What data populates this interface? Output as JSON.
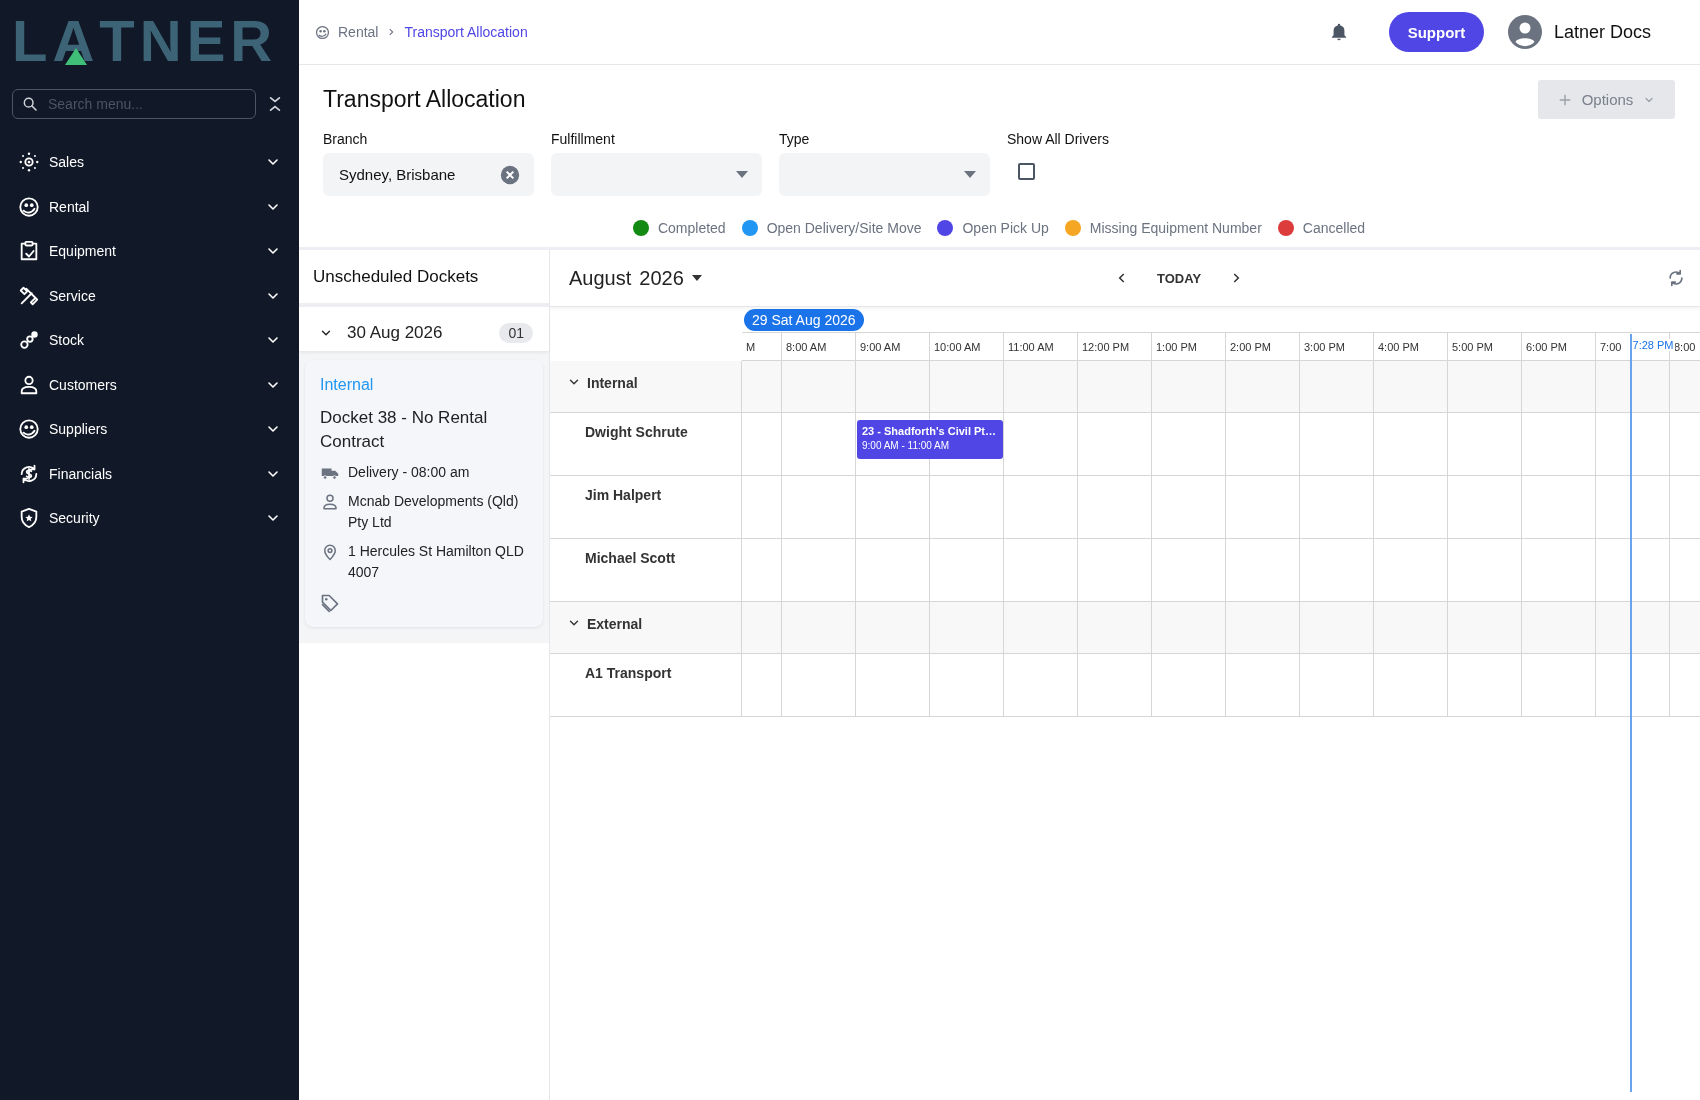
{
  "sidebar": {
    "logo": "LATNER",
    "search": {
      "placeholder": "Search menu..."
    },
    "items": [
      {
        "label": "Sales",
        "expanded": false
      },
      {
        "label": "Rental",
        "expanded": false
      },
      {
        "label": "Equipment",
        "expanded": false
      },
      {
        "label": "Service",
        "expanded": false
      },
      {
        "label": "Stock",
        "expanded": false
      },
      {
        "label": "Customers",
        "expanded": false
      },
      {
        "label": "Suppliers",
        "expanded": false
      },
      {
        "label": "Financials",
        "expanded": false
      },
      {
        "label": "Security",
        "expanded": false
      }
    ]
  },
  "topbar": {
    "breadcrumbs": [
      {
        "label": "Rental",
        "current": false
      },
      {
        "label": "Transport Allocation",
        "current": true
      }
    ],
    "support": "Support",
    "user": "Latner Docs"
  },
  "page": {
    "title": "Transport Allocation",
    "options": {
      "label": "Options",
      "disabled": true
    },
    "filters": [
      {
        "kind": "select",
        "label": "Branch",
        "value": "Sydney, Brisbane"
      },
      {
        "kind": "select",
        "label": "Fulfillment"
      },
      {
        "kind": "select",
        "label": "Type"
      },
      {
        "kind": "checkbox",
        "label": "Show All Drivers",
        "checked": false
      }
    ],
    "legend": [
      {
        "label": "Completed",
        "color": "#138a13"
      },
      {
        "label": "Open Delivery/Site Move",
        "color": "#2196f3"
      },
      {
        "label": "Open Pick Up",
        "color": "#4f46e5"
      },
      {
        "label": "Missing Equipment Number",
        "color": "#f5a623"
      },
      {
        "label": "Cancelled",
        "color": "#dc3c3c"
      }
    ]
  },
  "dockets": {
    "title": "Unscheduled Dockets",
    "groups": [
      {
        "date": "30 Aug 2026",
        "count": "01",
        "expanded": true,
        "items": [
          {
            "type": "Internal",
            "title": "Docket 38 - No Rental Contract",
            "delivery": "Delivery - 08:00 am",
            "customer": "Mcnab Developments (Qld) Pty Ltd",
            "address": "1 Hercules St Hamilton QLD 4007"
          }
        ]
      }
    ]
  },
  "scheduler": {
    "month": "August",
    "year": "2026",
    "today": "TODAY",
    "date_chip": "29 Sat Aug 2026",
    "now_label": "7:28 PM",
    "time_slots": [
      "M",
      "8:00 AM",
      "9:00 AM",
      "10:00 AM",
      "11:00 AM",
      "12:00 PM",
      "1:00 PM",
      "2:00 PM",
      "3:00 PM",
      "4:00 PM",
      "5:00 PM",
      "6:00 PM",
      "7:00",
      "8:00"
    ],
    "groups": [
      {
        "name": "Internal",
        "expanded": true,
        "resources": [
          {
            "name": "Dwight Schrute",
            "events": [
              {
                "title": "23 - Shadforth's Civil Pt…",
                "time": "9:00 AM - 11:00 AM",
                "color": "#4f46e5"
              }
            ]
          },
          {
            "name": "Jim Halpert"
          },
          {
            "name": "Michael Scott"
          }
        ]
      },
      {
        "name": "External",
        "expanded": true,
        "resources": [
          {
            "name": "A1 Transport"
          }
        ]
      }
    ]
  }
}
